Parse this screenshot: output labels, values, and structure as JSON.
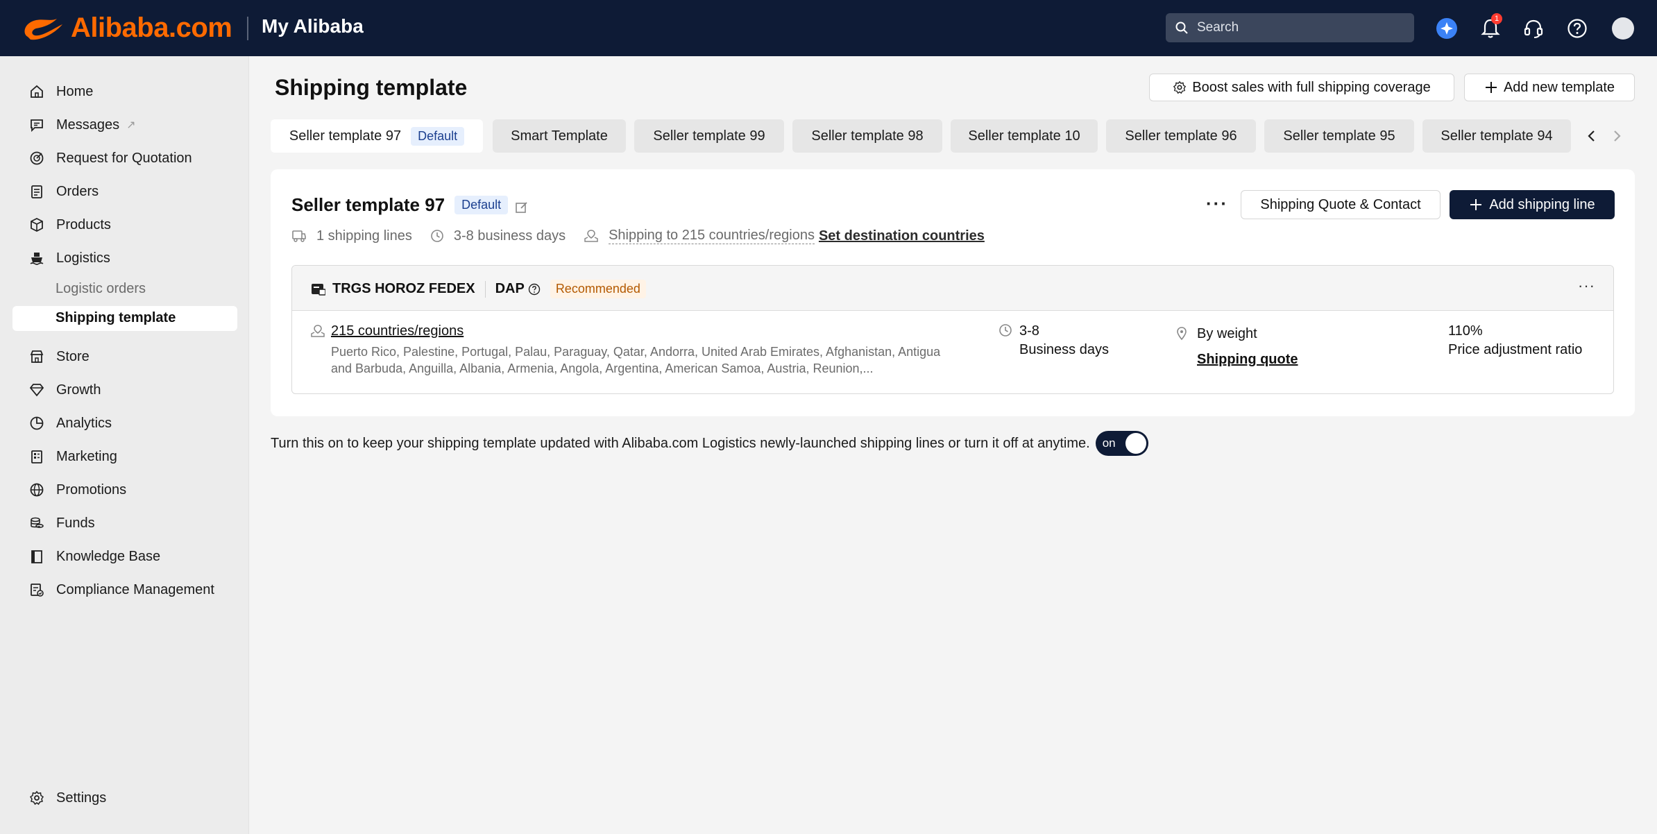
{
  "header": {
    "logo_text": "Alibaba.com",
    "app_title": "My Alibaba",
    "search_placeholder": "Search",
    "notification_count": "1",
    "icons": [
      "ai-assistant-icon",
      "bell-icon",
      "headset-icon",
      "help-icon",
      "avatar"
    ]
  },
  "sidebar": {
    "items": [
      {
        "label": "Home",
        "icon": "home-icon"
      },
      {
        "label": "Messages",
        "icon": "message-icon",
        "external": "↗"
      },
      {
        "label": "Request for Quotation",
        "icon": "rfq-icon"
      },
      {
        "label": "Orders",
        "icon": "orders-icon"
      },
      {
        "label": "Products",
        "icon": "products-icon"
      },
      {
        "label": "Logistics",
        "icon": "ship-icon"
      },
      {
        "label": "Store",
        "icon": "store-icon"
      },
      {
        "label": "Growth",
        "icon": "diamond-icon"
      },
      {
        "label": "Analytics",
        "icon": "pie-icon"
      },
      {
        "label": "Marketing",
        "icon": "marketing-icon"
      },
      {
        "label": "Promotions",
        "icon": "globe-icon"
      },
      {
        "label": "Funds",
        "icon": "coins-icon"
      },
      {
        "label": "Knowledge Base",
        "icon": "book-icon"
      },
      {
        "label": "Compliance Management",
        "icon": "compliance-icon"
      }
    ],
    "logistics_sub": [
      "Logistic orders",
      "Shipping template"
    ],
    "active_sub": "Shipping template",
    "settings_label": "Settings"
  },
  "main": {
    "title": "Shipping template",
    "boost_button": "Boost sales with full shipping coverage",
    "add_template_button": "Add new template",
    "tabs": [
      {
        "label": "Seller template 97",
        "tag": "Default",
        "active": true
      },
      {
        "label": "Smart Template"
      },
      {
        "label": "Seller template 99"
      },
      {
        "label": "Seller template 98"
      },
      {
        "label": "Seller template 10"
      },
      {
        "label": "Seller template 96"
      },
      {
        "label": "Seller template 95"
      },
      {
        "label": "Seller template 94"
      }
    ]
  },
  "template": {
    "name": "Seller template 97",
    "default_tag": "Default",
    "more": "···",
    "quote_contact_button": "Shipping Quote & Contact",
    "add_line_button": "Add shipping line",
    "shipping_lines": "1 shipping lines",
    "business_days": "3-8 business days",
    "shipping_to": "Shipping to 215 countries/regions",
    "set_destination": "Set destination countries"
  },
  "line": {
    "carrier": "TRGS HOROZ FEDEX",
    "incoterm": "DAP",
    "recommended": "Recommended",
    "more": "···",
    "countries_link": "215 countries/regions",
    "countries_list": "Puerto Rico, Palestine, Portugal, Palau, Paraguay, Qatar, Andorra, United Arab Emirates, Afghanistan, Antigua and Barbuda, Anguilla, Albania, Armenia, Angola, Argentina, American Samoa, Austria, Reunion,...",
    "days_value": "3-8",
    "days_label": "Business days",
    "pricing_method": "By weight",
    "shipping_quote": "Shipping quote",
    "ratio_value": "110%",
    "ratio_label": "Price adjustment ratio"
  },
  "footer": {
    "auto_update_text": "Turn this on to keep your shipping template updated with Alibaba.com Logistics newly-launched shipping lines or turn it off at anytime.",
    "toggle_label": "on",
    "toggle_state": true
  },
  "colors": {
    "header_bg": "#0e1b36",
    "brand_orange": "#ff6a00",
    "primary_button": "#0e1b36",
    "default_tag_bg": "#e6effd",
    "recommended_bg": "#fff3e6"
  }
}
